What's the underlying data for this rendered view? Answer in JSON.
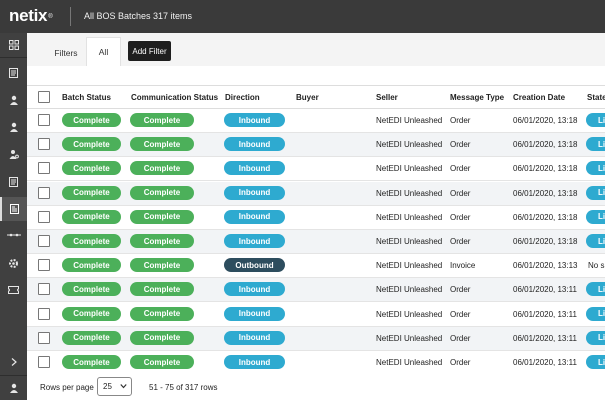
{
  "app": {
    "logo_text": "netix",
    "logo_mark": "®",
    "page_title": "All BOS Batches  317 items"
  },
  "sidebar": {
    "icons": [
      "dashboard-icon",
      "document-icon",
      "user-icon",
      "user-icon",
      "user-settings-icon",
      "document-icon",
      "document-active-icon",
      "connector-icon",
      "gear-icon",
      "ticket-icon",
      "chevron-right-icon",
      "account-icon"
    ]
  },
  "filters": {
    "filters_label": "Filters",
    "all_tab_label": "All",
    "add_filter_label": "Add Filter"
  },
  "table": {
    "headers": {
      "batch_status": "Batch Status",
      "comm_status": "Communication Status",
      "direction": "Direction",
      "buyer": "Buyer",
      "seller": "Seller",
      "message_type": "Message Type",
      "creation_date": "Creation Date",
      "state": "State"
    },
    "rows": [
      {
        "batch_status": "Complete",
        "comm_status": "Complete",
        "direction": "Inbound",
        "buyer": "",
        "seller": "NetEDI Unleashed",
        "message_type": "Order",
        "creation_date": "06/01/2020, 13:18",
        "state": "Li"
      },
      {
        "batch_status": "Complete",
        "comm_status": "Complete",
        "direction": "Inbound",
        "buyer": "",
        "seller": "NetEDI Unleashed",
        "message_type": "Order",
        "creation_date": "06/01/2020, 13:18",
        "state": "Li"
      },
      {
        "batch_status": "Complete",
        "comm_status": "Complete",
        "direction": "Inbound",
        "buyer": "",
        "seller": "NetEDI Unleashed",
        "message_type": "Order",
        "creation_date": "06/01/2020, 13:18",
        "state": "Li"
      },
      {
        "batch_status": "Complete",
        "comm_status": "Complete",
        "direction": "Inbound",
        "buyer": "",
        "seller": "NetEDI Unleashed",
        "message_type": "Order",
        "creation_date": "06/01/2020, 13:18",
        "state": "Li"
      },
      {
        "batch_status": "Complete",
        "comm_status": "Complete",
        "direction": "Inbound",
        "buyer": "",
        "seller": "NetEDI Unleashed",
        "message_type": "Order",
        "creation_date": "06/01/2020, 13:18",
        "state": "Li"
      },
      {
        "batch_status": "Complete",
        "comm_status": "Complete",
        "direction": "Inbound",
        "buyer": "",
        "seller": "NetEDI Unleashed",
        "message_type": "Order",
        "creation_date": "06/01/2020, 13:18",
        "state": "Li"
      },
      {
        "batch_status": "Complete",
        "comm_status": "Complete",
        "direction": "Outbound",
        "buyer": "",
        "seller": "NetEDI Unleashed",
        "message_type": "Invoice",
        "creation_date": "06/01/2020, 13:13",
        "state": "No s"
      },
      {
        "batch_status": "Complete",
        "comm_status": "Complete",
        "direction": "Inbound",
        "buyer": "",
        "seller": "NetEDI Unleashed",
        "message_type": "Order",
        "creation_date": "06/01/2020, 13:11",
        "state": "Li"
      },
      {
        "batch_status": "Complete",
        "comm_status": "Complete",
        "direction": "Inbound",
        "buyer": "",
        "seller": "NetEDI Unleashed",
        "message_type": "Order",
        "creation_date": "06/01/2020, 13:11",
        "state": "Li"
      },
      {
        "batch_status": "Complete",
        "comm_status": "Complete",
        "direction": "Inbound",
        "buyer": "",
        "seller": "NetEDI Unleashed",
        "message_type": "Order",
        "creation_date": "06/01/2020, 13:11",
        "state": "Li"
      },
      {
        "batch_status": "Complete",
        "comm_status": "Complete",
        "direction": "Inbound",
        "buyer": "",
        "seller": "NetEDI Unleashed",
        "message_type": "Order",
        "creation_date": "06/01/2020, 13:11",
        "state": "Li"
      }
    ]
  },
  "footer": {
    "rows_per_page_label": "Rows per page",
    "rows_per_page_value": "25",
    "range_text": "51 - 75 of 317 rows"
  },
  "colors": {
    "complete": "#4cb05a",
    "inbound": "#2eaad0",
    "outbound": "#2d4d5e",
    "topbar": "#3a3a3a",
    "sidebar": "#404040"
  }
}
